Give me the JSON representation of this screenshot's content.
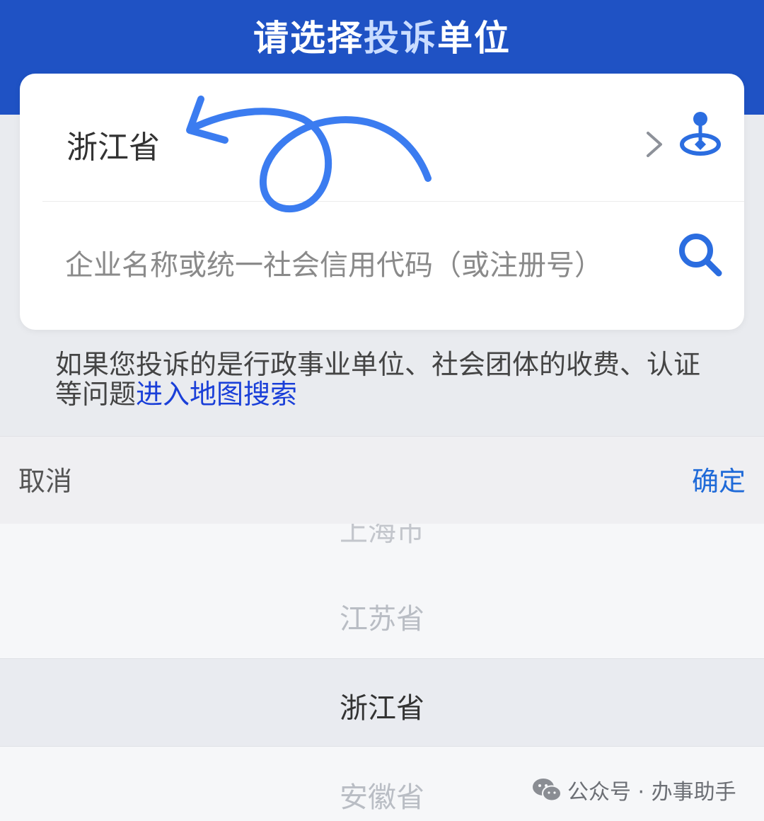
{
  "header": {
    "title_part1": "请选择",
    "title_part2": "投诉",
    "title_part3": "单位"
  },
  "card": {
    "province": "浙江省",
    "search_placeholder": "企业名称或统一社会信用代码（或注册号）"
  },
  "note": {
    "text": "如果您投诉的是行政事业单位、社会团体的收费、认证等问题",
    "link": "进入地图搜索"
  },
  "sheet": {
    "cancel_label": "取消",
    "confirm_label": "确定"
  },
  "picker": {
    "items": [
      "上海市",
      "江苏省",
      "浙江省",
      "安徽省"
    ],
    "selected": "浙江省"
  },
  "watermark": {
    "text": "公众号 · 办事助手"
  },
  "colors": {
    "header_bg": "#1f52c4",
    "link": "#1a3fd8",
    "confirm": "#1f6ad8",
    "icon_blue": "#2b6de0"
  }
}
